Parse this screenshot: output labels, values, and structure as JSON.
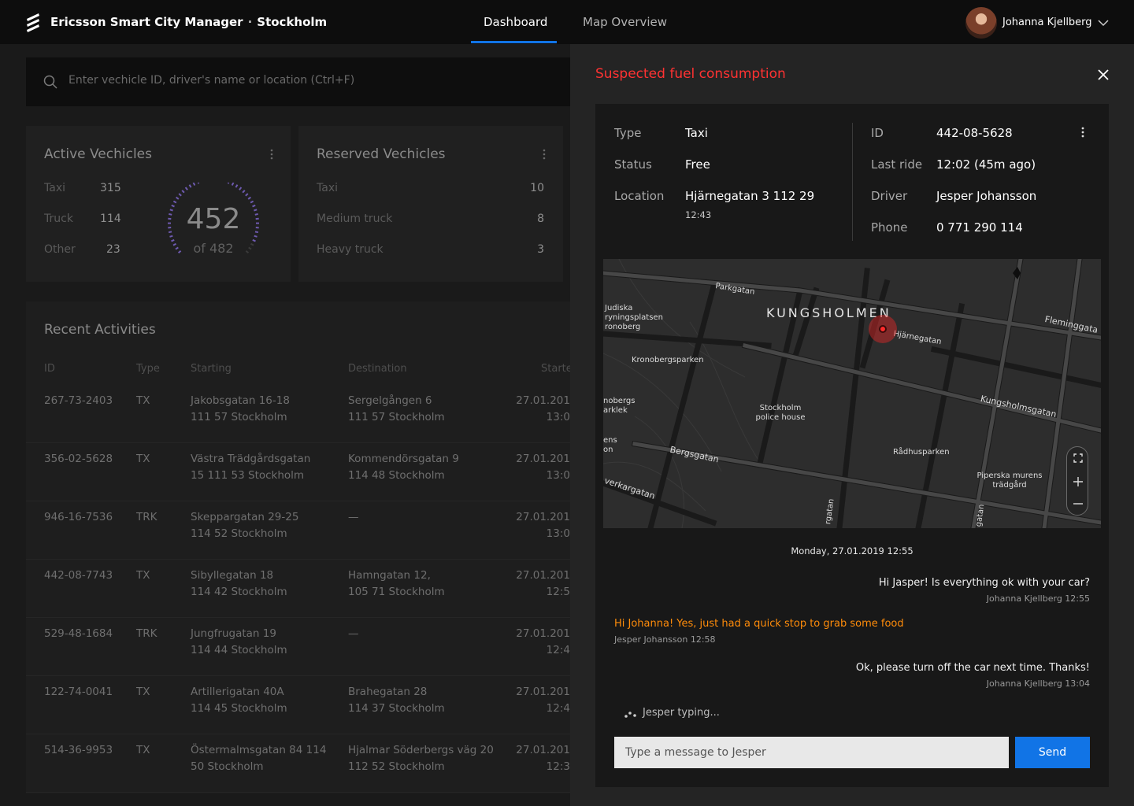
{
  "header": {
    "app_name": "Ericsson Smart City Manager",
    "separator": "·",
    "city": "Stockholm",
    "tabs": [
      {
        "label": "Dashboard",
        "active": true
      },
      {
        "label": "Map Overview",
        "active": false
      }
    ],
    "user_name": "Johanna Kjellberg",
    "accent_color": "#1174e6"
  },
  "search": {
    "placeholder": "Enter vechicle ID, driver's name or location (Ctrl+F)"
  },
  "active_vehicles": {
    "title": "Active Vechicles",
    "rows": [
      {
        "label": "Taxi",
        "value": "315"
      },
      {
        "label": "Truck",
        "value": "114"
      },
      {
        "label": "Other",
        "value": "23"
      }
    ],
    "total": "452",
    "of_label": "of 482",
    "gauge_fraction": 0.938
  },
  "reserved_vehicles": {
    "title": "Reserved Vechicles",
    "rows": [
      {
        "label": "Taxi",
        "value": "10"
      },
      {
        "label": "Medium truck",
        "value": "8"
      },
      {
        "label": "Heavy truck",
        "value": "3"
      }
    ]
  },
  "recent_activities": {
    "title": "Recent Activities",
    "columns": [
      "ID",
      "Type",
      "Starting",
      "Destination",
      "Starte"
    ],
    "rows": [
      {
        "id": "267-73-2403",
        "type": "TX",
        "start_1": "Jakobsgatan 16-18",
        "start_2": "111 57 Stockholm",
        "dest_1": "Sergelgången 6",
        "dest_2": "111 57 Stockholm",
        "date": "27.01.201",
        "time": "13:0"
      },
      {
        "id": "356-02-5628",
        "type": "TX",
        "start_1": "Västra Trädgårdsgatan",
        "start_2": "15 111 53 Stockholm",
        "dest_1": "Kommendörsgatan 9",
        "dest_2": "114 48 Stockholm",
        "date": "27.01.201",
        "time": "13:0"
      },
      {
        "id": "946-16-7536",
        "type": "TRK",
        "start_1": "Skeppargatan 29-25",
        "start_2": "114 52 Stockholm",
        "dest_1": "—",
        "dest_2": "",
        "date": "27.01.201",
        "time": "13:0"
      },
      {
        "id": "442-08-7743",
        "type": "TX",
        "start_1": "Sibyllegatan 18",
        "start_2": "114 42 Stockholm",
        "dest_1": "Hamngatan 12,",
        "dest_2": "105 71 Stockholm",
        "date": "27.01.201",
        "time": "12:5"
      },
      {
        "id": "529-48-1684",
        "type": "TRK",
        "start_1": "Jungfrugatan 19",
        "start_2": "114 44 Stockholm",
        "dest_1": "—",
        "dest_2": "",
        "date": "27.01.201",
        "time": "12:4"
      },
      {
        "id": "122-74-0041",
        "type": "TX",
        "start_1": "Artillerigatan 40A",
        "start_2": "114 45 Stockholm",
        "dest_1": "Brahegatan 28",
        "dest_2": "114 37 Stockholm",
        "date": "27.01.201",
        "time": "12:4"
      },
      {
        "id": "514-36-9953",
        "type": "TX",
        "start_1": "Östermalmsgatan 84 114",
        "start_2": "50 Stockholm",
        "dest_1": "Hjalmar Söderbergs väg 20",
        "dest_2": "112 52 Stockholm",
        "date": "27.01.201",
        "time": "12:3"
      }
    ]
  },
  "alert": {
    "title": "Suspected fuel consumption",
    "color": "#ff3232",
    "details": {
      "type_label": "Type",
      "type_value": "Taxi",
      "status_label": "Status",
      "status_value": "Free",
      "location_label": "Location",
      "location_value": "Hjärnegatan 3 112 29",
      "location_time": "12:43",
      "id_label": "ID",
      "id_value": "442-08-5628",
      "last_ride_label": "Last ride",
      "last_ride_value": "12:02 (45m ago)",
      "driver_label": "Driver",
      "driver_value": "Jesper Johansson",
      "phone_label": "Phone",
      "phone_value": "0 771 290 114"
    },
    "map": {
      "district": "KUNGSHOLMEN",
      "labels": {
        "parkgatan": "Parkgatan",
        "judiska_1": "Judiska",
        "judiska_2": "ryningsplatsen",
        "judiska_3": "ronoberg",
        "hjarnegatan": "Hjärnegatan",
        "fleminggatan": "Fleminggata",
        "kronobergsparken": "Kronobergsparken",
        "obergs_1": "nobergs",
        "obergs_2": "arklek",
        "police_1": "Stockholm",
        "police_2": "police house",
        "kungsholmsgatan": "Kungsholmsgatan",
        "ens_1": "ens",
        "ens_2": "on",
        "bergsgatan": "Bergsgatan",
        "radhusparken": "Rådhusparken",
        "piperska_1": "Piperska murens",
        "piperska_2": "trädgård",
        "verkargatan": "verkargatan",
        "rgatan": "rgatan",
        "gatan": "gatan"
      }
    },
    "chat": {
      "date": "Monday, 27.01.2019  12:55",
      "messages": [
        {
          "text": "Hi Jasper! Is everything ok with your car?",
          "meta": "Johanna Kjellberg 12:55"
        },
        {
          "text": "Hi Johanna! Yes, just had a quick stop to grab some food",
          "meta": "Jesper Johansson 12:58"
        },
        {
          "text": "Ok, please turn off the car next time. Thanks!",
          "meta": "Johanna Kjellberg 13:04"
        }
      ],
      "typing": "Jesper typing...",
      "input_placeholder": "Type a message to Jesper",
      "send_label": "Send"
    }
  }
}
